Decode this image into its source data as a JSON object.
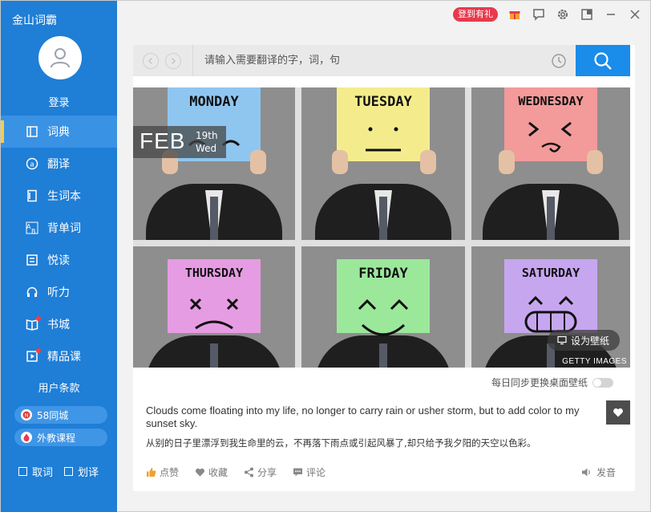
{
  "app": {
    "title": "金山词霸"
  },
  "user": {
    "login_label": "登录"
  },
  "sidebar": {
    "items": [
      {
        "label": "词典",
        "icon": "book-icon",
        "active": true
      },
      {
        "label": "翻译",
        "icon": "translate-icon"
      },
      {
        "label": "生词本",
        "icon": "notebook-icon"
      },
      {
        "label": "背单词",
        "icon": "flashcard-icon"
      },
      {
        "label": "悦读",
        "icon": "reading-icon"
      },
      {
        "label": "听力",
        "icon": "headphones-icon"
      },
      {
        "label": "书城",
        "icon": "bookstore-icon",
        "badge": true
      },
      {
        "label": "精品课",
        "icon": "video-course-icon",
        "badge": true
      }
    ],
    "terms_label": "用户条款",
    "promos": [
      {
        "label": "58同城",
        "icon": "58-logo-icon"
      },
      {
        "label": "外教课程",
        "icon": "flame-icon"
      }
    ],
    "options": [
      {
        "label": "取词"
      },
      {
        "label": "划译"
      }
    ]
  },
  "topbar": {
    "checkin_label": "登到有礼"
  },
  "search": {
    "placeholder": "请输入需要翻译的字，词，句"
  },
  "daily": {
    "date": {
      "month": "FEB",
      "day": "19th",
      "weekday": "Wed"
    },
    "tiles": [
      {
        "word": "MONDAY",
        "color": "#8fc6f0"
      },
      {
        "word": "TUESDAY",
        "color": "#f4ec8c"
      },
      {
        "word": "WEDNESDAY",
        "color": "#f39a9a"
      },
      {
        "word": "THURSDAY",
        "color": "#e69ce3"
      },
      {
        "word": "FRIDAY",
        "color": "#9be89b"
      },
      {
        "word": "SATURDAY",
        "color": "#c7a6f0"
      }
    ],
    "set_wallpaper_label": "设为壁纸",
    "credit": "GETTY IMAGES",
    "sync_label": "每日同步更换桌面壁纸",
    "quote_en": "Clouds come floating into my life, no longer to carry rain or usher storm, but to add color to my sunset sky.",
    "quote_zh": "从别的日子里漂浮到我生命里的云，不再落下雨点或引起风暴了,却只给予我夕阳的天空以色彩。",
    "actions": [
      {
        "label": "点赞",
        "icon": "thumbs-up-icon"
      },
      {
        "label": "收藏",
        "icon": "heart-icon"
      },
      {
        "label": "分享",
        "icon": "share-icon"
      },
      {
        "label": "评论",
        "icon": "comment-icon"
      }
    ],
    "pronounce_label": "发音"
  }
}
